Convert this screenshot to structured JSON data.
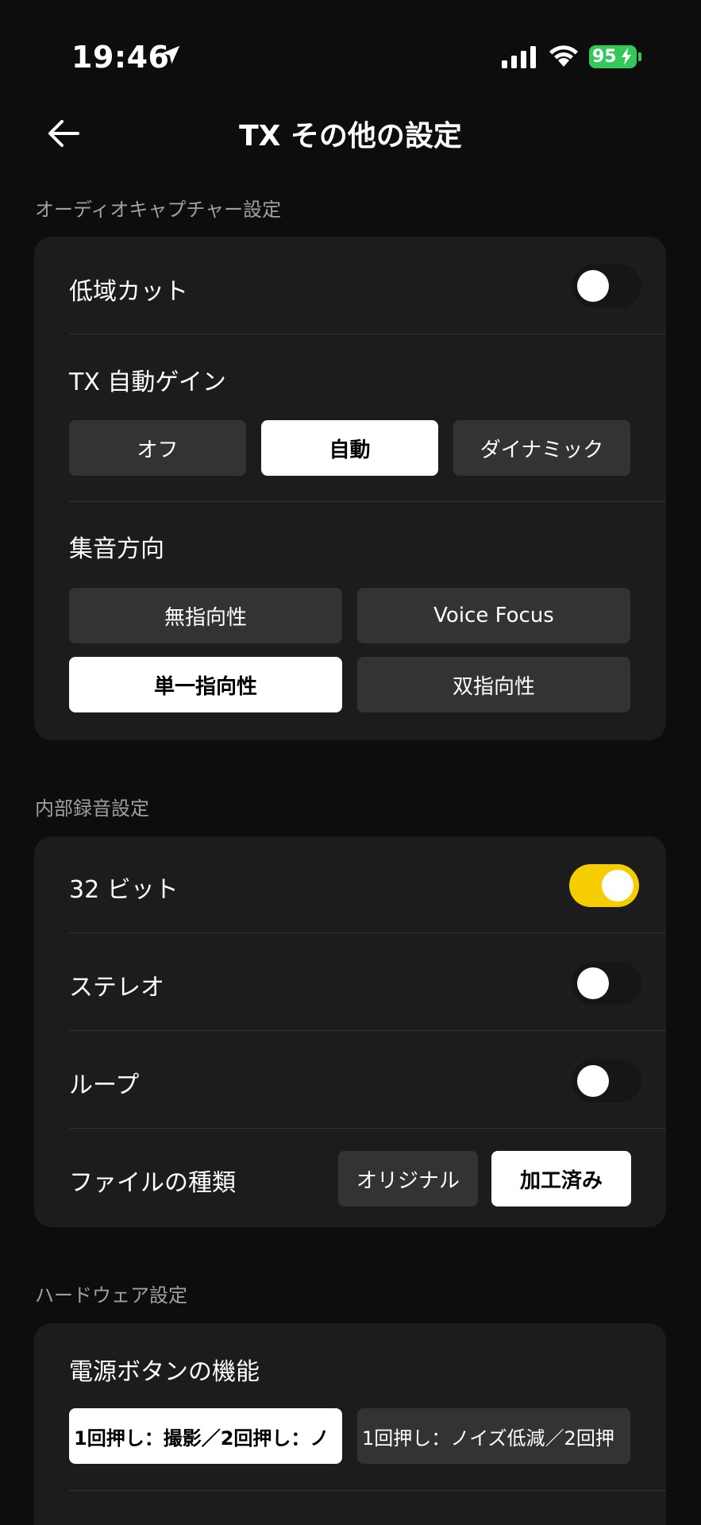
{
  "status": {
    "time": "19:46",
    "battery": "95"
  },
  "nav": {
    "title": "TX その他の設定"
  },
  "audio_capture": {
    "header": "オーディオキャプチャー設定",
    "low_cut_label": "低域カット",
    "auto_gain": {
      "label": "TX 自動ゲイン",
      "options": [
        "オフ",
        "自動",
        "ダイナミック"
      ],
      "selected": "自動"
    },
    "pickup": {
      "label": "集音方向",
      "options": [
        "無指向性",
        "Voice Focus",
        "単一指向性",
        "双指向性"
      ],
      "selected": "単一指向性"
    }
  },
  "internal_recording": {
    "header": "内部録音設定",
    "bit32_label": "32 ビット",
    "stereo_label": "ステレオ",
    "loop_label": "ループ",
    "file_type": {
      "label": "ファイルの種類",
      "options": [
        "オリジナル",
        "加工済み"
      ],
      "selected": "加工済み"
    }
  },
  "hardware": {
    "header": "ハードウェア設定",
    "power_button_label": "電源ボタンの機能",
    "options": [
      "1回押し：撮影／2回押し：ノ",
      "1回押し：ノイズ低減／2回押"
    ],
    "selected": "1回押し：撮影／2回押し：ノ"
  },
  "toggles": {
    "low_cut": false,
    "bit32": true,
    "stereo": false,
    "loop": false
  },
  "colors": {
    "accent": "#f5cd00",
    "battery": "#34c759",
    "background": "#0d0d0d",
    "card": "#1c1c1c"
  }
}
